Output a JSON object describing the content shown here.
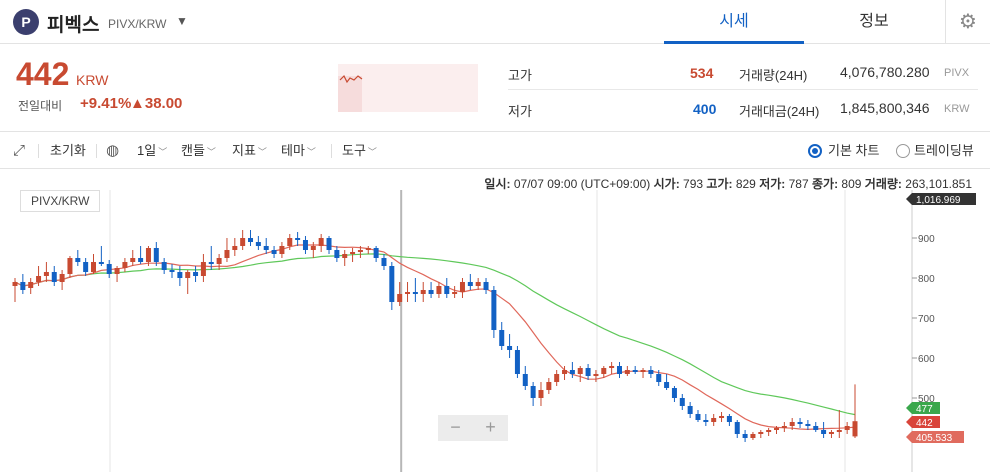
{
  "header": {
    "logo_letter": "P",
    "coin_name": "피벡스",
    "coin_pair": "PIVX/KRW",
    "tabs": [
      {
        "label": "시세"
      },
      {
        "label": "정보"
      }
    ]
  },
  "summary": {
    "price": "442",
    "price_unit": "KRW",
    "change_label": "전일대비",
    "change_rate": "+9.41%",
    "change_amount": "▲38.00",
    "high_label": "고가",
    "high_value": "534",
    "low_label": "저가",
    "low_value": "400",
    "volume_label": "거래량(24H)",
    "volume_value": "4,076,780.280",
    "volume_unit": "PIVX",
    "turnover_label": "거래대금(24H)",
    "turnover_value": "1,845,800,346",
    "turnover_unit": "KRW"
  },
  "toolbar": {
    "reset": "초기화",
    "interval": "1일",
    "chart_type": "캔들",
    "indicator": "지표",
    "theme": "테마",
    "tools": "도구",
    "basic_chart": "기본 차트",
    "trading_view": "트레이딩뷰"
  },
  "ohlc": {
    "date_label": "일시:",
    "date_value": "07/07 09:00 (UTC+09:00)",
    "open_label": "시가:",
    "open_value": "793",
    "high_label": "고가:",
    "high_value": "829",
    "low_label": "저가:",
    "low_value": "787",
    "close_label": "종가:",
    "close_value": "809",
    "vol_label": "거래량:",
    "vol_value": "263,101.851"
  },
  "chart_data": {
    "type": "candlestick",
    "pair_label": "PIVX/KRW",
    "y_ticks": [
      900,
      800,
      700,
      600,
      500
    ],
    "ylim": [
      400,
      1000
    ],
    "price_labels": {
      "top": "1,016.969",
      "ma_short": "477",
      "current": "442",
      "ma_long": "405.533"
    },
    "colors": {
      "up": "#c84a31",
      "down": "#1261c4",
      "ma_short": "#e0685b",
      "ma_long": "#5fc85a"
    },
    "candles": [
      {
        "o": 780,
        "h": 800,
        "l": 740,
        "c": 790
      },
      {
        "o": 790,
        "h": 810,
        "l": 760,
        "c": 770
      },
      {
        "o": 775,
        "h": 800,
        "l": 760,
        "c": 790
      },
      {
        "o": 790,
        "h": 830,
        "l": 780,
        "c": 805
      },
      {
        "o": 805,
        "h": 840,
        "l": 790,
        "c": 815
      },
      {
        "o": 815,
        "h": 830,
        "l": 780,
        "c": 790
      },
      {
        "o": 790,
        "h": 820,
        "l": 770,
        "c": 810
      },
      {
        "o": 810,
        "h": 855,
        "l": 800,
        "c": 850
      },
      {
        "o": 850,
        "h": 870,
        "l": 830,
        "c": 840
      },
      {
        "o": 840,
        "h": 850,
        "l": 805,
        "c": 815
      },
      {
        "o": 815,
        "h": 860,
        "l": 810,
        "c": 840
      },
      {
        "o": 840,
        "h": 880,
        "l": 830,
        "c": 835
      },
      {
        "o": 835,
        "h": 845,
        "l": 800,
        "c": 810
      },
      {
        "o": 810,
        "h": 830,
        "l": 790,
        "c": 825
      },
      {
        "o": 825,
        "h": 850,
        "l": 815,
        "c": 840
      },
      {
        "o": 840,
        "h": 870,
        "l": 830,
        "c": 850
      },
      {
        "o": 850,
        "h": 880,
        "l": 835,
        "c": 840
      },
      {
        "o": 840,
        "h": 880,
        "l": 830,
        "c": 875
      },
      {
        "o": 875,
        "h": 890,
        "l": 830,
        "c": 840
      },
      {
        "o": 840,
        "h": 850,
        "l": 810,
        "c": 820
      },
      {
        "o": 820,
        "h": 835,
        "l": 800,
        "c": 815
      },
      {
        "o": 815,
        "h": 830,
        "l": 780,
        "c": 800
      },
      {
        "o": 800,
        "h": 820,
        "l": 760,
        "c": 815
      },
      {
        "o": 815,
        "h": 830,
        "l": 790,
        "c": 805
      },
      {
        "o": 805,
        "h": 860,
        "l": 790,
        "c": 840
      },
      {
        "o": 840,
        "h": 880,
        "l": 820,
        "c": 835
      },
      {
        "o": 835,
        "h": 860,
        "l": 820,
        "c": 850
      },
      {
        "o": 850,
        "h": 900,
        "l": 840,
        "c": 870
      },
      {
        "o": 870,
        "h": 900,
        "l": 855,
        "c": 880
      },
      {
        "o": 880,
        "h": 920,
        "l": 870,
        "c": 900
      },
      {
        "o": 900,
        "h": 920,
        "l": 880,
        "c": 890
      },
      {
        "o": 890,
        "h": 905,
        "l": 870,
        "c": 880
      },
      {
        "o": 880,
        "h": 900,
        "l": 860,
        "c": 870
      },
      {
        "o": 870,
        "h": 880,
        "l": 850,
        "c": 860
      },
      {
        "o": 860,
        "h": 890,
        "l": 850,
        "c": 880
      },
      {
        "o": 880,
        "h": 910,
        "l": 870,
        "c": 900
      },
      {
        "o": 900,
        "h": 915,
        "l": 880,
        "c": 895
      },
      {
        "o": 895,
        "h": 905,
        "l": 860,
        "c": 870
      },
      {
        "o": 870,
        "h": 890,
        "l": 850,
        "c": 880
      },
      {
        "o": 880,
        "h": 910,
        "l": 865,
        "c": 900
      },
      {
        "o": 900,
        "h": 905,
        "l": 860,
        "c": 870
      },
      {
        "o": 870,
        "h": 880,
        "l": 840,
        "c": 850
      },
      {
        "o": 850,
        "h": 870,
        "l": 830,
        "c": 860
      },
      {
        "o": 860,
        "h": 875,
        "l": 840,
        "c": 865
      },
      {
        "o": 865,
        "h": 880,
        "l": 850,
        "c": 870
      },
      {
        "o": 870,
        "h": 880,
        "l": 860,
        "c": 875
      },
      {
        "o": 875,
        "h": 880,
        "l": 840,
        "c": 850
      },
      {
        "o": 850,
        "h": 860,
        "l": 820,
        "c": 830
      },
      {
        "o": 830,
        "h": 840,
        "l": 720,
        "c": 740
      },
      {
        "o": 740,
        "h": 790,
        "l": 730,
        "c": 760
      },
      {
        "o": 760,
        "h": 790,
        "l": 740,
        "c": 765
      },
      {
        "o": 765,
        "h": 800,
        "l": 740,
        "c": 760
      },
      {
        "o": 760,
        "h": 790,
        "l": 740,
        "c": 770
      },
      {
        "o": 770,
        "h": 790,
        "l": 750,
        "c": 760
      },
      {
        "o": 760,
        "h": 790,
        "l": 750,
        "c": 780
      },
      {
        "o": 780,
        "h": 800,
        "l": 750,
        "c": 760
      },
      {
        "o": 760,
        "h": 780,
        "l": 750,
        "c": 765
      },
      {
        "o": 765,
        "h": 800,
        "l": 750,
        "c": 790
      },
      {
        "o": 790,
        "h": 810,
        "l": 770,
        "c": 780
      },
      {
        "o": 780,
        "h": 800,
        "l": 770,
        "c": 790
      },
      {
        "o": 790,
        "h": 800,
        "l": 760,
        "c": 770
      },
      {
        "o": 770,
        "h": 780,
        "l": 650,
        "c": 670
      },
      {
        "o": 670,
        "h": 690,
        "l": 620,
        "c": 630
      },
      {
        "o": 630,
        "h": 660,
        "l": 600,
        "c": 620
      },
      {
        "o": 620,
        "h": 630,
        "l": 550,
        "c": 560
      },
      {
        "o": 560,
        "h": 580,
        "l": 520,
        "c": 530
      },
      {
        "o": 530,
        "h": 540,
        "l": 480,
        "c": 500
      },
      {
        "o": 500,
        "h": 540,
        "l": 480,
        "c": 520
      },
      {
        "o": 520,
        "h": 550,
        "l": 510,
        "c": 540
      },
      {
        "o": 540,
        "h": 570,
        "l": 530,
        "c": 560
      },
      {
        "o": 560,
        "h": 580,
        "l": 545,
        "c": 570
      },
      {
        "o": 570,
        "h": 590,
        "l": 550,
        "c": 560
      },
      {
        "o": 560,
        "h": 580,
        "l": 540,
        "c": 575
      },
      {
        "o": 575,
        "h": 585,
        "l": 545,
        "c": 555
      },
      {
        "o": 555,
        "h": 570,
        "l": 540,
        "c": 560
      },
      {
        "o": 560,
        "h": 580,
        "l": 550,
        "c": 575
      },
      {
        "o": 575,
        "h": 590,
        "l": 560,
        "c": 580
      },
      {
        "o": 580,
        "h": 590,
        "l": 550,
        "c": 560
      },
      {
        "o": 560,
        "h": 580,
        "l": 555,
        "c": 570
      },
      {
        "o": 570,
        "h": 580,
        "l": 560,
        "c": 565
      },
      {
        "o": 565,
        "h": 575,
        "l": 550,
        "c": 570
      },
      {
        "o": 570,
        "h": 580,
        "l": 550,
        "c": 560
      },
      {
        "o": 560,
        "h": 570,
        "l": 530,
        "c": 540
      },
      {
        "o": 540,
        "h": 560,
        "l": 520,
        "c": 525
      },
      {
        "o": 525,
        "h": 530,
        "l": 490,
        "c": 500
      },
      {
        "o": 500,
        "h": 510,
        "l": 470,
        "c": 480
      },
      {
        "o": 480,
        "h": 490,
        "l": 450,
        "c": 460
      },
      {
        "o": 460,
        "h": 470,
        "l": 440,
        "c": 445
      },
      {
        "o": 445,
        "h": 460,
        "l": 430,
        "c": 440
      },
      {
        "o": 440,
        "h": 460,
        "l": 430,
        "c": 450
      },
      {
        "o": 450,
        "h": 465,
        "l": 440,
        "c": 455
      },
      {
        "o": 455,
        "h": 460,
        "l": 430,
        "c": 440
      },
      {
        "o": 440,
        "h": 445,
        "l": 400,
        "c": 410
      },
      {
        "o": 410,
        "h": 420,
        "l": 390,
        "c": 400
      },
      {
        "o": 400,
        "h": 415,
        "l": 395,
        "c": 410
      },
      {
        "o": 410,
        "h": 420,
        "l": 400,
        "c": 415
      },
      {
        "o": 415,
        "h": 425,
        "l": 405,
        "c": 420
      },
      {
        "o": 420,
        "h": 430,
        "l": 410,
        "c": 425
      },
      {
        "o": 425,
        "h": 440,
        "l": 415,
        "c": 430
      },
      {
        "o": 430,
        "h": 450,
        "l": 420,
        "c": 440
      },
      {
        "o": 440,
        "h": 450,
        "l": 425,
        "c": 435
      },
      {
        "o": 435,
        "h": 445,
        "l": 420,
        "c": 430
      },
      {
        "o": 430,
        "h": 440,
        "l": 415,
        "c": 420
      },
      {
        "o": 420,
        "h": 440,
        "l": 400,
        "c": 410
      },
      {
        "o": 410,
        "h": 420,
        "l": 400,
        "c": 415
      },
      {
        "o": 415,
        "h": 470,
        "l": 400,
        "c": 420
      },
      {
        "o": 420,
        "h": 440,
        "l": 410,
        "c": 430
      },
      {
        "o": 404,
        "h": 534,
        "l": 400,
        "c": 442
      }
    ]
  }
}
